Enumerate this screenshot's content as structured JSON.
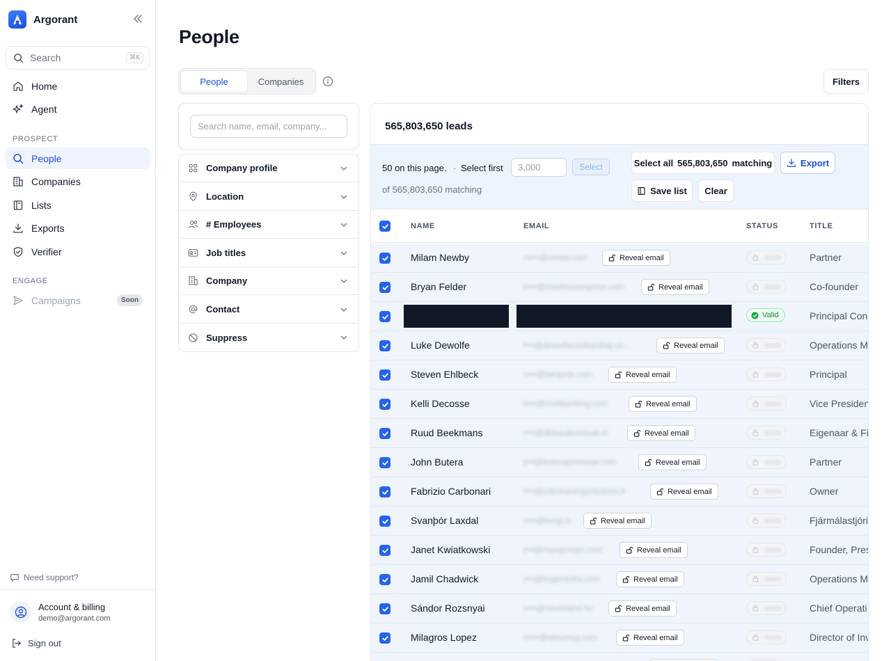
{
  "sidebar": {
    "brand": "Argorant",
    "search_label": "Search",
    "search_shortcut": "⌘K",
    "nav_main": [
      {
        "label": "Home",
        "icon": "home-icon"
      },
      {
        "label": "Agent",
        "icon": "sparkle-icon"
      }
    ],
    "prospect_section": "PROSPECT",
    "nav_prospect": [
      {
        "label": "People",
        "icon": "search-icon",
        "active": true
      },
      {
        "label": "Companies",
        "icon": "building-icon"
      },
      {
        "label": "Lists",
        "icon": "book-icon"
      },
      {
        "label": "Exports",
        "icon": "download-icon"
      },
      {
        "label": "Verifier",
        "icon": "shield-check-icon"
      }
    ],
    "engage_section": "ENGAGE",
    "campaigns_label": "Campaigns",
    "campaigns_badge": "Soon",
    "support": "Need support?",
    "account_title": "Account & billing",
    "account_email": "demo@argorant.com",
    "signout": "Sign out"
  },
  "main": {
    "title": "People",
    "tabs": [
      {
        "label": "People",
        "active": true
      },
      {
        "label": "Companies",
        "active": false
      }
    ],
    "filters_button": "Filters"
  },
  "filters": {
    "search_placeholder": "Search name, email, company...",
    "items": [
      {
        "label": "Company profile",
        "icon": "grid-icon"
      },
      {
        "label": "Location",
        "icon": "map-pin-icon"
      },
      {
        "label": "# Employees",
        "icon": "users-icon"
      },
      {
        "label": "Job titles",
        "icon": "id-card-icon"
      },
      {
        "label": "Company",
        "icon": "building-icon"
      },
      {
        "label": "Contact",
        "icon": "at-icon"
      },
      {
        "label": "Suppress",
        "icon": "ban-icon"
      }
    ]
  },
  "results": {
    "leads_count": "565,803,650 leads",
    "on_page": "50 on this page.",
    "dot": "·",
    "select_first": "Select first",
    "select_first_placeholder": "3,000",
    "select_button": "Select",
    "matching_text": "of 565,803,650 matching",
    "select_all": "Select all",
    "select_all_count": "565,803,650",
    "select_all_suffix": "matching",
    "export": "Export",
    "save_list": "Save list",
    "clear": "Clear",
    "columns": [
      "NAME",
      "EMAIL",
      "STATUS",
      "TITLE"
    ],
    "reveal_label": "Reveal email",
    "rows": [
      {
        "name": "Milam Newby",
        "email": "m•••@vetaw.com",
        "title": "Partner",
        "status": "locked"
      },
      {
        "name": "Bryan Felder",
        "email": "b•••@maxhousesprice.com",
        "title": "Co-founder",
        "status": "locked"
      },
      {
        "name": "",
        "email": "",
        "title": "Principal Con",
        "status": "Valid",
        "redacted": true
      },
      {
        "name": "Luke Dewolfe",
        "email": "l•••@dewolfecontracting.co...",
        "title": "Operations M",
        "status": "locked"
      },
      {
        "name": "Steven Ehlbeck",
        "email": "s•••@serapds.com",
        "title": "Principal",
        "status": "locked"
      },
      {
        "name": "Kelli Decosse",
        "email": "k•••@mvbbanking.com",
        "title": "Vice Presiden",
        "status": "locked"
      },
      {
        "name": "Ruud Beekmans",
        "email": "r•••@dkbaudiovisual.nl",
        "title": "Eigenaar & Fi",
        "status": "locked"
      },
      {
        "name": "John Butera",
        "email": "j•••@buterajoneslaw.com",
        "title": "Partner",
        "status": "locked"
      },
      {
        "name": "Fabrizio Carbonari",
        "email": "f•••@crbcleaningsolutions.it",
        "title": "Owner",
        "status": "locked"
      },
      {
        "name": "Svanþór Laxdal",
        "email": "s•••@tengi.is",
        "title": "Fjármálastjóri",
        "status": "locked"
      },
      {
        "name": "Janet Kwiatkowski",
        "email": "j•••@maegroups.com",
        "title": "Founder, Pres",
        "status": "locked"
      },
      {
        "name": "Jamil Chadwick",
        "email": "j•••@hugeninfra.com",
        "title": "Operations M",
        "status": "locked"
      },
      {
        "name": "Sándor Rozsnyai",
        "email": "s•••@neverland.hu",
        "title": "Chief Operati",
        "status": "locked"
      },
      {
        "name": "Milagros Lopez",
        "email": "m•••@atriumcg.com",
        "title": "Director of Inv",
        "status": "locked"
      },
      {
        "name": "",
        "email": "",
        "title": "",
        "status": "locked"
      }
    ]
  },
  "colors": {
    "accent": "#2563eb",
    "active_nav_bg": "#eff4ff",
    "toolbar_bg": "#eef4fd",
    "valid_green": "#15803d"
  }
}
